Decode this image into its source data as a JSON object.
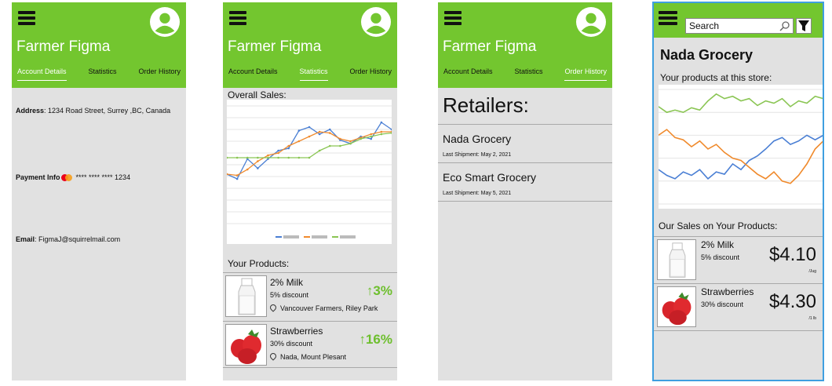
{
  "app": {
    "title": "Farmer Figma",
    "tabs": [
      "Account Details",
      "Statistics",
      "Order History"
    ]
  },
  "account": {
    "address_label": "Address",
    "address_value": ": 1234 Road Street, Surrey ,BC, Canada",
    "payment_label": "Payment Info",
    "payment_value": "**** **** **** 1234",
    "email_label": "Email",
    "email_value": ":  FigmaJ@squirrelmail.com"
  },
  "statistics": {
    "overall_label": "Overall Sales:",
    "products_label": "Your Products:",
    "products": [
      {
        "name": "2% Milk",
        "discount": "5% discount",
        "location": "Vancouver Farmers, Riley Park",
        "change": "↑3%",
        "image_icon": "milk-bottle"
      },
      {
        "name": "Strawberries",
        "discount": "30% discount",
        "location": "Nada, Mount Plesant",
        "change": "↑16%",
        "image_icon": "strawberries"
      }
    ]
  },
  "orders": {
    "title": "Retailers:",
    "retailers": [
      {
        "name": "Nada Grocery",
        "shipment": "Last Shipment: May 2, 2021"
      },
      {
        "name": "Eco Smart Grocery",
        "shipment": "Last Shipment: May 5, 2021"
      }
    ]
  },
  "store": {
    "search_placeholder": "Search",
    "name": "Nada Grocery",
    "products_label": "Your products at this store:",
    "sales_label": "Our Sales on Your Products:",
    "products": [
      {
        "name": "2% Milk",
        "discount": "5% discount",
        "price": "$4.10",
        "unit": "/Jug",
        "image_icon": "milk-bottle"
      },
      {
        "name": "Strawberries",
        "discount": "30% discount",
        "price": "$4.30",
        "unit": "/1 lb",
        "image_icon": "strawberries"
      }
    ]
  },
  "colors": {
    "header_green": "#73c62f",
    "screen_gray": "#e1e1e1",
    "accent_green": "#6dbf2d",
    "selection_blue": "#3f9fe0",
    "line_blue": "#4a7fd4",
    "line_orange": "#f08a2c",
    "line_green": "#8ac553"
  },
  "chart_data": [
    {
      "type": "line",
      "series": [
        {
          "values": [
            0.42,
            0.38,
            0.55,
            0.47,
            0.55,
            0.62,
            0.64,
            0.79,
            0.82,
            0.76,
            0.8,
            0.71,
            0.68,
            0.74,
            0.72,
            0.86,
            0.8
          ]
        },
        {
          "values": [
            0.42,
            0.41,
            0.46,
            0.53,
            0.58,
            0.6,
            0.66,
            0.7,
            0.74,
            0.78,
            0.77,
            0.72,
            0.7,
            0.73,
            0.76,
            0.78,
            0.78
          ]
        },
        {
          "values": [
            0.56,
            0.56,
            0.56,
            0.56,
            0.56,
            0.56,
            0.56,
            0.56,
            0.56,
            0.62,
            0.66,
            0.66,
            0.68,
            0.72,
            0.74,
            0.76,
            0.77
          ]
        }
      ]
    },
    {
      "type": "line",
      "series": [
        {
          "values": [
            0.3,
            0.25,
            0.22,
            0.28,
            0.25,
            0.3,
            0.22,
            0.28,
            0.26,
            0.35,
            0.3,
            0.38,
            0.42,
            0.48,
            0.55,
            0.58,
            0.52,
            0.55,
            0.6,
            0.56,
            0.6
          ]
        },
        {
          "values": [
            0.6,
            0.65,
            0.58,
            0.56,
            0.5,
            0.55,
            0.48,
            0.52,
            0.45,
            0.4,
            0.38,
            0.32,
            0.26,
            0.22,
            0.28,
            0.2,
            0.18,
            0.25,
            0.35,
            0.48,
            0.55
          ]
        },
        {
          "values": [
            0.85,
            0.8,
            0.82,
            0.8,
            0.84,
            0.82,
            0.9,
            0.96,
            0.92,
            0.94,
            0.9,
            0.92,
            0.86,
            0.9,
            0.88,
            0.92,
            0.85,
            0.9,
            0.88,
            0.94,
            0.92
          ]
        }
      ]
    }
  ]
}
